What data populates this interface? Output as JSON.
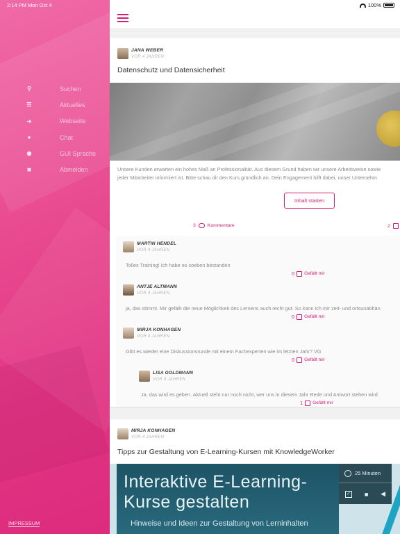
{
  "status": {
    "time": "2:14 PM",
    "date": "Mon Oct 4",
    "battery": "100%"
  },
  "sidebar": {
    "items": [
      {
        "icon": "search-icon",
        "glyph": "⚲",
        "label": "Suchen"
      },
      {
        "icon": "list-icon",
        "glyph": "☰",
        "label": "Aktuelles"
      },
      {
        "icon": "arrow-right-icon",
        "glyph": "➜",
        "label": "Webseite"
      },
      {
        "icon": "chat-icon",
        "glyph": "●",
        "label": "Chat"
      },
      {
        "icon": "globe-icon",
        "glyph": "◉",
        "label": "GUI Sprache"
      },
      {
        "icon": "close-icon",
        "glyph": "✖",
        "label": "Abmelden"
      }
    ],
    "footer": "IMPRESSUM"
  },
  "accent": "#d81b78",
  "posts": [
    {
      "author": "JANA WEBER",
      "time": "VOR 4 JAHREN",
      "title": "Datenschutz und Datensicherheit",
      "desc_line1": "Unsere Kunden erwarten ein hohes Maß an Professionalität. Aus diesem Grund haben wir unsere Arbeitsweise sowie",
      "desc_line2": "jeder Mitarbeiter informiert ist. Bitte schau dir den Kurs gründlich an. Dein Engagement hilft dabei, unser Unternehm",
      "cta": "Inhalt starten",
      "comment_count": "3",
      "comment_label": "Kommentare",
      "like_count": "2",
      "comments": [
        {
          "author": "MARTIN HENDEL",
          "time": "VOR 4 JAHREN",
          "text": "Tolles Training! Ich habe es soeben bestanden",
          "likes": "0",
          "like_label": "Gefällt mir"
        },
        {
          "author": "ANTJE ALTMANN",
          "time": "VOR 4 JAHREN",
          "text": "ja, das stimmt. Mir gefällt die neue Möglichkeit des Lernens auch recht gut. So kann ich mir zeit- und ortsunabhän",
          "likes": "0",
          "like_label": "Gefällt mir"
        },
        {
          "author": "MIRJA KONHAGEN",
          "time": "VOR 4 JAHREN",
          "text": "Gibt es wieder eine Diskussionsrunde mit einem Fachexperten wie im letzten Jahr? VG",
          "likes": "0",
          "like_label": "Gefällt mir"
        },
        {
          "author": "LISA GOLDMANN",
          "time": "VOR 4 JAHREN",
          "text": "Ja, das wird es geben. Aktuell steht nur noch nicht, wer uns in diesem Jahr Rede und Antwort stehen wird.",
          "likes": "1",
          "like_label": "Gefällt mir"
        }
      ]
    },
    {
      "author": "MIRJA KONHAGEN",
      "time": "VOR 4 JAHREN",
      "title": "Tipps zur Gestaltung von E-Learning-Kursen mit KnowledgeWorker",
      "image": {
        "line1": "Interaktive E-Learning-",
        "line2": "Kurse gestalten",
        "subtitle": "Hinweise und Ideen zur Gestaltung von Lerninhalten",
        "duration": "25 Minuten"
      }
    }
  ]
}
